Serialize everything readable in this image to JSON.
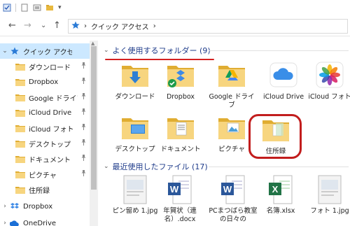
{
  "toolbar": {
    "dropdown_glyph": "▾"
  },
  "address": {
    "back": "←",
    "forward": "→",
    "recent": "⌄",
    "up": "↑",
    "path_sep": "›",
    "path_label": "クイック アクセス",
    "path_end": "›"
  },
  "sidebar": {
    "items": [
      {
        "label": "クイック アクセス",
        "icon": "star-icon",
        "pinned": false,
        "expander": "⌄"
      },
      {
        "label": "ダウンロード",
        "icon": "download-folder-icon",
        "pinned": true
      },
      {
        "label": "Dropbox",
        "icon": "dropbox-folder-icon",
        "pinned": true
      },
      {
        "label": "Google ドライブ",
        "icon": "google-drive-folder-icon",
        "pinned": true
      },
      {
        "label": "iCloud Drive",
        "icon": "icloud-icon",
        "pinned": true
      },
      {
        "label": "iCloud フォト",
        "icon": "icloud-photos-icon",
        "pinned": true
      },
      {
        "label": "デスクトップ",
        "icon": "desktop-folder-icon",
        "pinned": true
      },
      {
        "label": "ドキュメント",
        "icon": "documents-folder-icon",
        "pinned": true
      },
      {
        "label": "ピクチャ",
        "icon": "pictures-folder-icon",
        "pinned": true
      },
      {
        "label": "住所録",
        "icon": "folder-icon",
        "pinned": false
      },
      {
        "label": "Dropbox",
        "icon": "dropbox-icon",
        "pinned": false,
        "expander": "›"
      },
      {
        "label": "OneDrive",
        "icon": "onedrive-icon",
        "pinned": false,
        "expander": "›"
      }
    ],
    "pin_glyph": "📌"
  },
  "frequent": {
    "title": "よく使用するフォルダー (9)",
    "chevron": "⌄",
    "tiles": [
      {
        "label": "ダウンロード",
        "icon": "download-folder-icon"
      },
      {
        "label": "Dropbox",
        "icon": "dropbox-folder-icon"
      },
      {
        "label": "Google ドライブ",
        "icon": "google-drive-folder-icon"
      },
      {
        "label": "iCloud Drive",
        "icon": "icloud-drive-icon"
      },
      {
        "label": "iCloud フォト",
        "icon": "icloud-photos-icon"
      },
      {
        "label": "デスクトップ",
        "icon": "desktop-folder-icon"
      },
      {
        "label": "ドキュメント",
        "icon": "documents-folder-icon"
      },
      {
        "label": "ピクチャ",
        "icon": "pictures-folder-icon"
      },
      {
        "label": "住所録",
        "icon": "folder-icon"
      }
    ]
  },
  "recent": {
    "title": "最近使用したファイル (17)",
    "chevron": "⌄",
    "files": [
      {
        "label": "ピン留め 1.jpg",
        "icon": "image-file-icon"
      },
      {
        "label": "年賀状（連名）.docx",
        "icon": "word-file-icon",
        "badge": "W"
      },
      {
        "label": "PCまつばら教室の日々の",
        "icon": "word-file-icon",
        "badge": "W"
      },
      {
        "label": "名簿.xlsx",
        "icon": "excel-file-icon",
        "badge": "X"
      },
      {
        "label": "フォト 1.jpg",
        "icon": "image-file-icon"
      }
    ]
  },
  "colors": {
    "accent": "#1e3b8a",
    "selection": "#cce8ff",
    "highlight_red": "#c21d1d",
    "folder_yellow": "#f6d27a"
  }
}
